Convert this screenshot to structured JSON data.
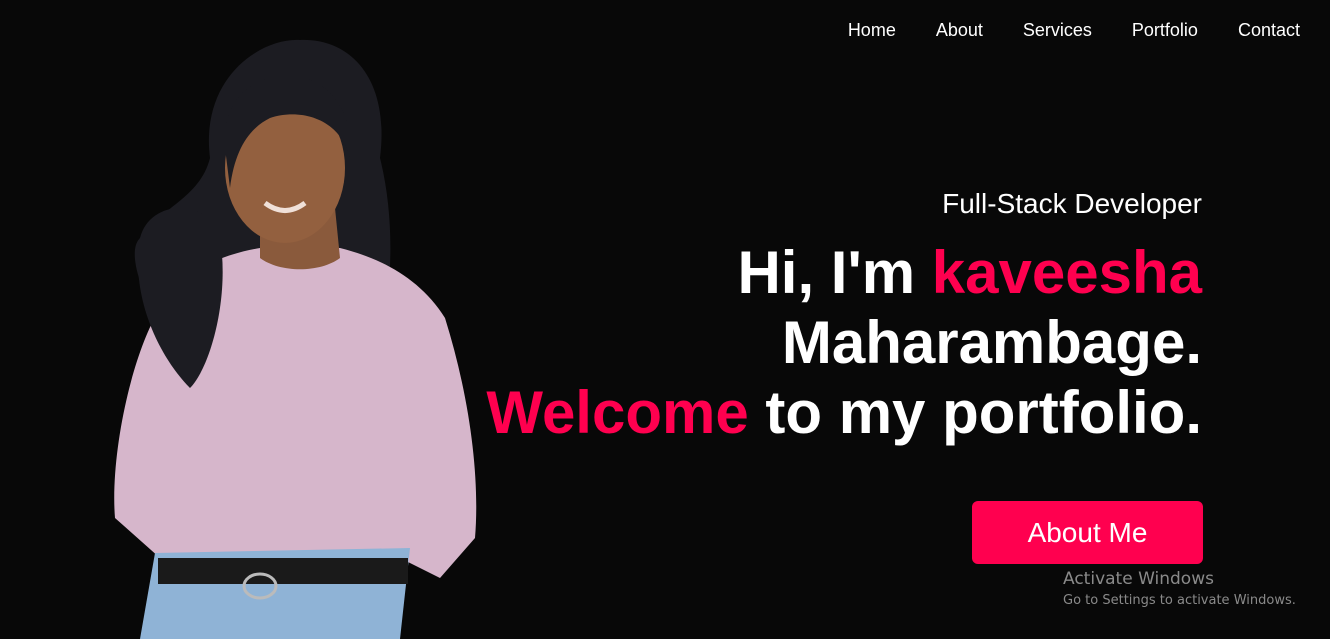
{
  "nav": {
    "items": [
      "Home",
      "About",
      "Services",
      "Portfolio",
      "Contact"
    ]
  },
  "hero": {
    "subtitle": "Full-Stack Developer",
    "line1_prefix": "Hi, I'm ",
    "line1_name": "kaveesha",
    "line2": "Maharambage.",
    "line3_accent": "Welcome",
    "line3_rest": " to my portfolio.",
    "button_label": "About Me"
  },
  "watermark": {
    "title": "Activate Windows",
    "subtitle": "Go to Settings to activate Windows."
  },
  "colors": {
    "background": "#080808",
    "accent": "#ff004f",
    "text": "#ffffff"
  }
}
